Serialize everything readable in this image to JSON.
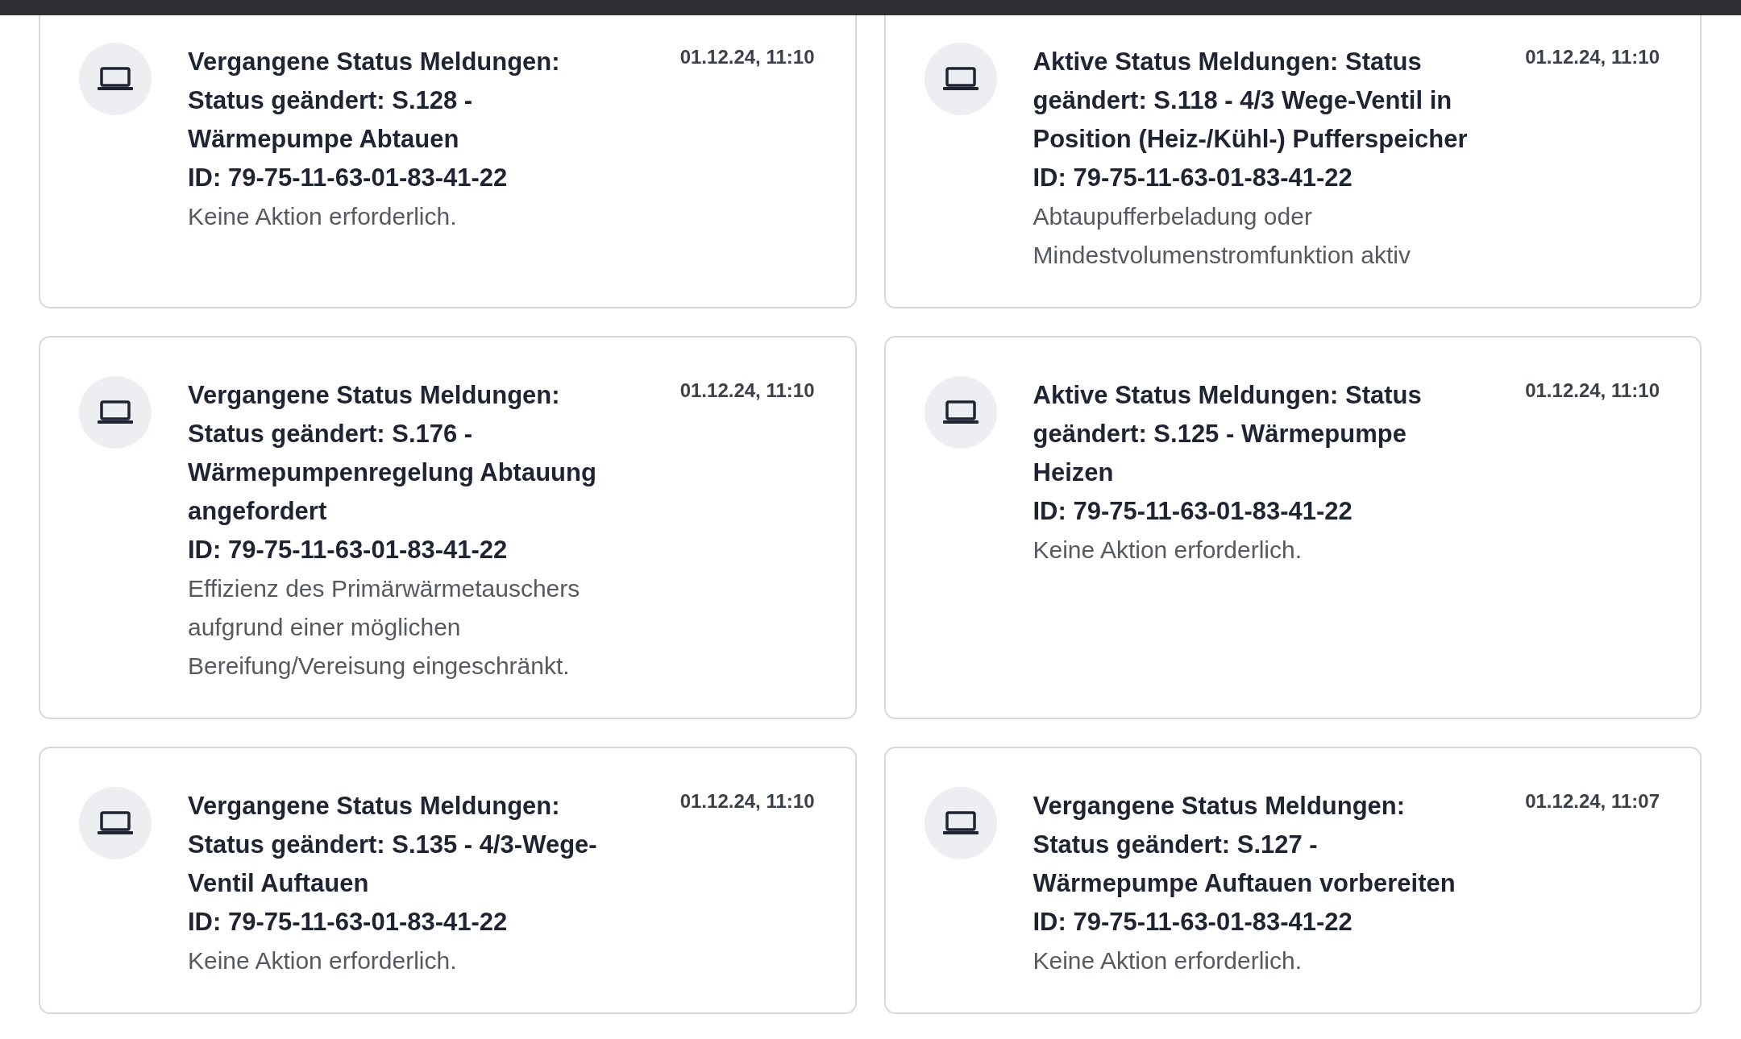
{
  "messages": [
    {
      "title": "Vergangene Status Meldungen: Status geändert: S.128 - Wärmepumpe Abtauen",
      "id": "ID: 79-75-11-63-01-83-41-22",
      "description": "Keine Aktion erforderlich.",
      "date": "01.12.24, 11:10"
    },
    {
      "title": "Aktive Status Meldungen: Status geändert: S.118 - 4/3 Wege-Ventil in Position (Heiz-/Kühl-) Pufferspeicher",
      "id": "ID: 79-75-11-63-01-83-41-22",
      "description": "Abtaupufferbeladung oder Mindestvolumenstromfunktion aktiv",
      "date": "01.12.24, 11:10"
    },
    {
      "title": "Vergangene Status Meldungen: Status geändert: S.176 - Wärmepumpenregelung Abtauung angefordert",
      "id": "ID: 79-75-11-63-01-83-41-22",
      "description": "Effizienz des Primärwärmetauschers aufgrund einer möglichen Bereifung/Vereisung eingeschränkt.",
      "date": "01.12.24, 11:10"
    },
    {
      "title": "Aktive Status Meldungen: Status geändert: S.125 - Wärmepumpe Heizen",
      "id": "ID: 79-75-11-63-01-83-41-22",
      "description": "Keine Aktion erforderlich.",
      "date": "01.12.24, 11:10"
    },
    {
      "title": "Vergangene Status Meldungen: Status geändert: S.135 - 4/3-Wege-Ventil Auftauen",
      "id": "ID: 79-75-11-63-01-83-41-22",
      "description": "Keine Aktion erforderlich.",
      "date": "01.12.24, 11:10"
    },
    {
      "title": "Vergangene Status Meldungen: Status geändert: S.127 - Wärmepumpe Auftauen vorbereiten",
      "id": "ID: 79-75-11-63-01-83-41-22",
      "description": "Keine Aktion erforderlich.",
      "date": "01.12.24, 11:07"
    }
  ]
}
